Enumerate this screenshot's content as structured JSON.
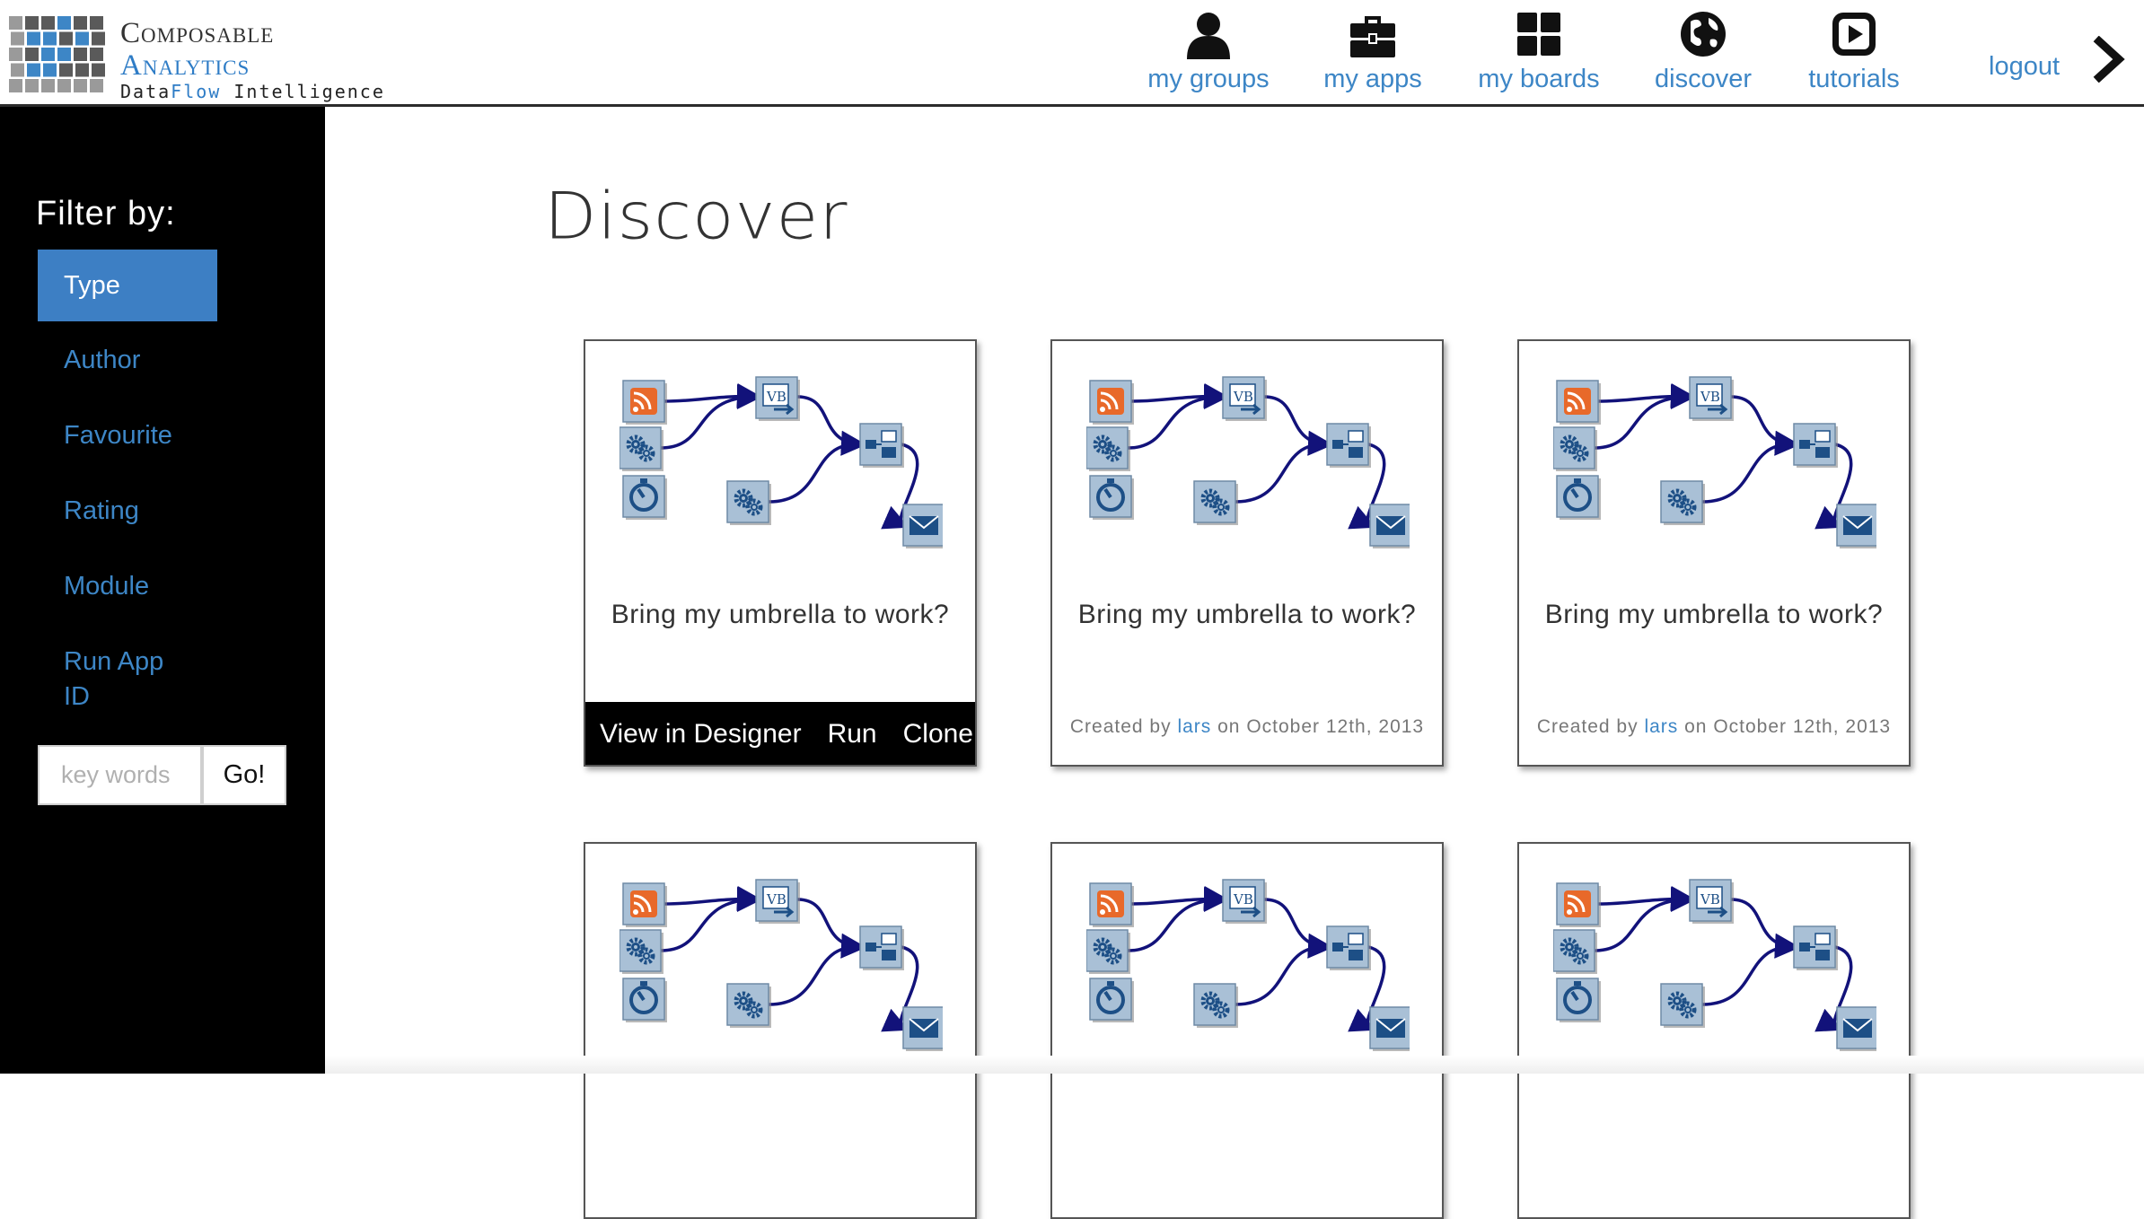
{
  "header": {
    "logo": {
      "line1": "Composable",
      "line2": "Analytics",
      "line3_prefix": "Data",
      "line3_flow": "Flow",
      "line3_suffix": " Intelligence"
    },
    "nav": [
      {
        "label": "my groups",
        "icon": "person-icon"
      },
      {
        "label": "my apps",
        "icon": "briefcase-icon"
      },
      {
        "label": "my boards",
        "icon": "grid-icon"
      },
      {
        "label": "discover",
        "icon": "globe-icon"
      },
      {
        "label": "tutorials",
        "icon": "play-icon"
      }
    ],
    "logout_label": "logout"
  },
  "sidebar": {
    "filter_title": "Filter by:",
    "filters": [
      {
        "label": "Type",
        "active": true
      },
      {
        "label": "Author",
        "active": false
      },
      {
        "label": "Favourite",
        "active": false
      },
      {
        "label": "Rating",
        "active": false
      },
      {
        "label": "Module",
        "active": false
      },
      {
        "label": "Run App ID",
        "active": false
      }
    ],
    "search": {
      "placeholder": "key words",
      "value": "",
      "button_label": "Go!"
    }
  },
  "main": {
    "title": "Discover",
    "cards": [
      {
        "title": "Bring my umbrella to work?",
        "hovered": true,
        "actions": [
          "View in Designer",
          "Run",
          "Clone"
        ],
        "created_prefix": "Created by",
        "author": "lars",
        "created_suffix": "on October 12th, 2013"
      },
      {
        "title": "Bring my umbrella to work?",
        "hovered": false,
        "created_prefix": "Created by",
        "author": "lars",
        "created_suffix": "on October 12th, 2013"
      },
      {
        "title": "Bring my umbrella to work?",
        "hovered": false,
        "created_prefix": "Created by",
        "author": "lars",
        "created_suffix": "on October 12th, 2013"
      },
      {
        "title": "",
        "hovered": false
      },
      {
        "title": "",
        "hovered": false
      },
      {
        "title": "",
        "hovered": false
      }
    ],
    "diagram_modules": [
      "rss-icon",
      "gears-icon",
      "timer-icon",
      "gears-icon",
      "vb-script-icon",
      "merge-icon",
      "email-icon"
    ]
  },
  "colors": {
    "accent": "#3d86c6",
    "active_filter_bg": "#3d7fc4",
    "sidebar_bg": "#000000",
    "rss_orange": "#e8692a",
    "module_bg": "#a9c0d6",
    "connector": "#12127a"
  }
}
